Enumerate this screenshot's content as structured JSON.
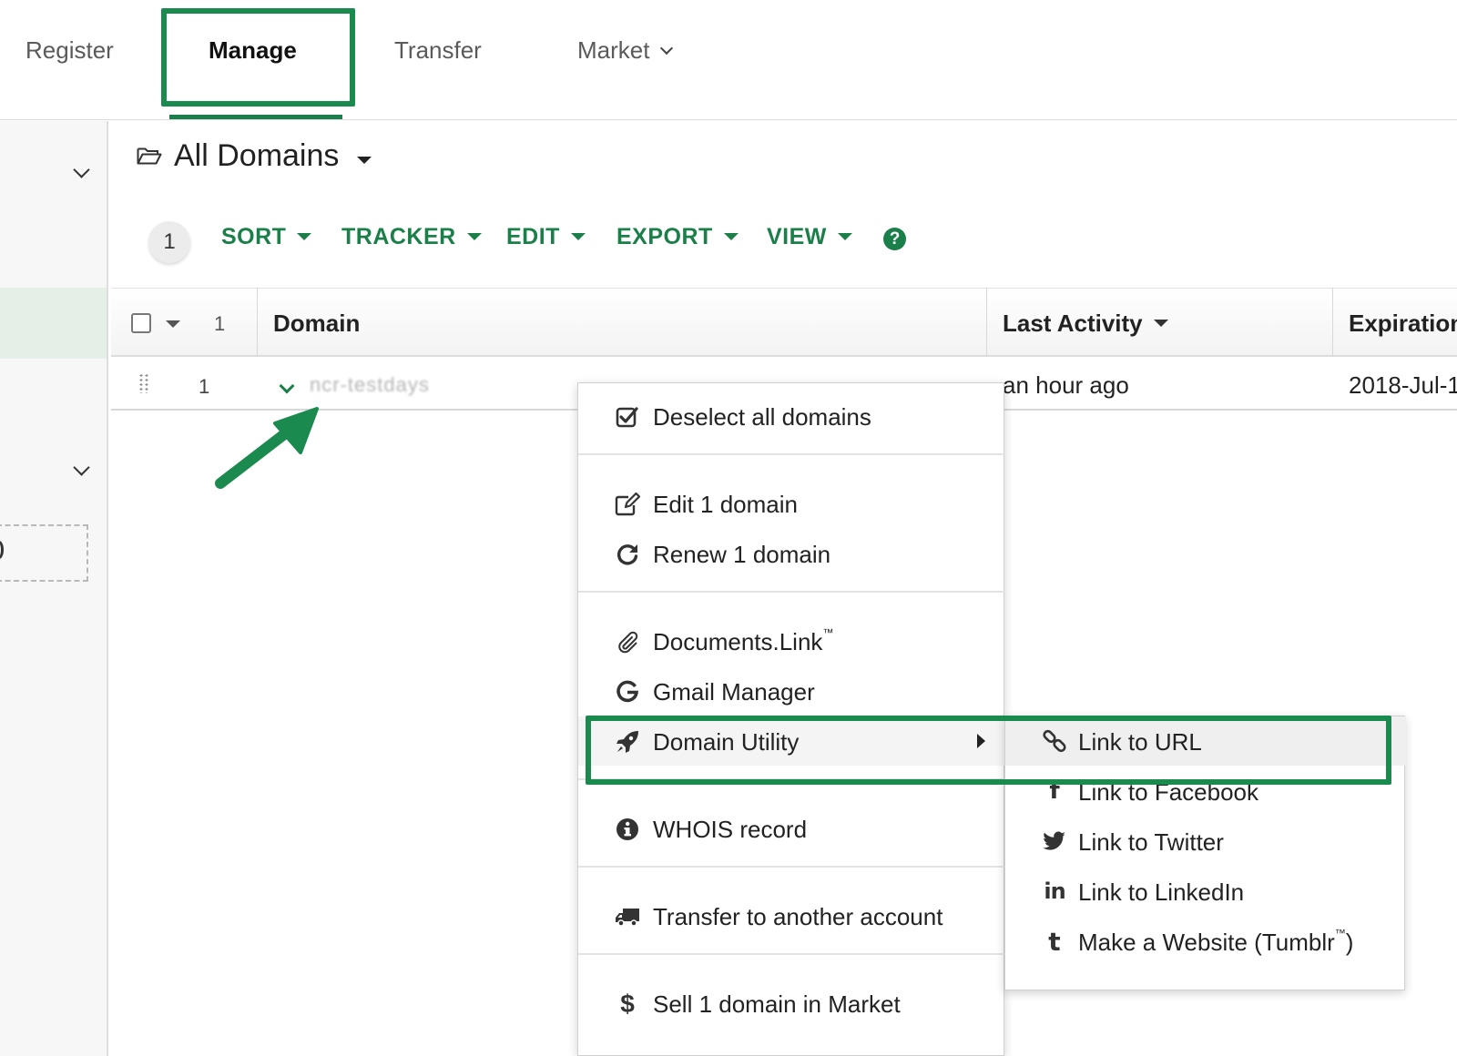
{
  "nav": {
    "tabs": [
      {
        "label": "Register"
      },
      {
        "label": "Manage"
      },
      {
        "label": "Transfer"
      },
      {
        "label": "Market"
      }
    ]
  },
  "page": {
    "title": "All Domains"
  },
  "toolbar": {
    "count": "1",
    "sort": "SORT",
    "tracker": "TRACKER",
    "edit": "EDIT",
    "export": "EXPORT",
    "view": "VIEW",
    "help_glyph": "?"
  },
  "table": {
    "header_count": "1",
    "columns": [
      "Domain",
      "Last Activity",
      "Expiration"
    ],
    "rows": [
      {
        "num": "1",
        "domain": "ncr-testdays",
        "last_activity": "an hour ago",
        "expiration": "2018-Jul-1"
      }
    ]
  },
  "context_menu": {
    "items": [
      {
        "label": "Deselect all domains",
        "icon": "checkbox-checked-icon"
      },
      {
        "label": "Edit 1 domain",
        "icon": "edit-icon"
      },
      {
        "label": "Renew 1 domain",
        "icon": "renew-icon"
      },
      {
        "label": "Documents.Link",
        "icon": "paperclip-icon",
        "trademark": "™"
      },
      {
        "label": "Gmail Manager",
        "icon": "google-icon"
      },
      {
        "label": "Domain Utility",
        "icon": "rocket-icon"
      },
      {
        "label": "WHOIS record",
        "icon": "info-icon"
      },
      {
        "label": "Transfer to another account",
        "icon": "truck-icon"
      },
      {
        "label": "Sell 1 domain in Market",
        "icon": "dollar-icon"
      }
    ]
  },
  "submenu": {
    "items": [
      {
        "label": "Link to URL",
        "icon": "link-icon"
      },
      {
        "label": "Link to Facebook",
        "icon": "facebook-icon"
      },
      {
        "label": "Link to Twitter",
        "icon": "twitter-icon"
      },
      {
        "label": "Link to LinkedIn",
        "icon": "linkedin-icon"
      },
      {
        "label": "Make a Website (Tumblr",
        "icon": "tumblr-icon",
        "trademark": "™",
        "suffix": ")"
      }
    ]
  },
  "colors": {
    "brand_green": "#1b7f49",
    "annotation_green": "#1a8a4e"
  }
}
